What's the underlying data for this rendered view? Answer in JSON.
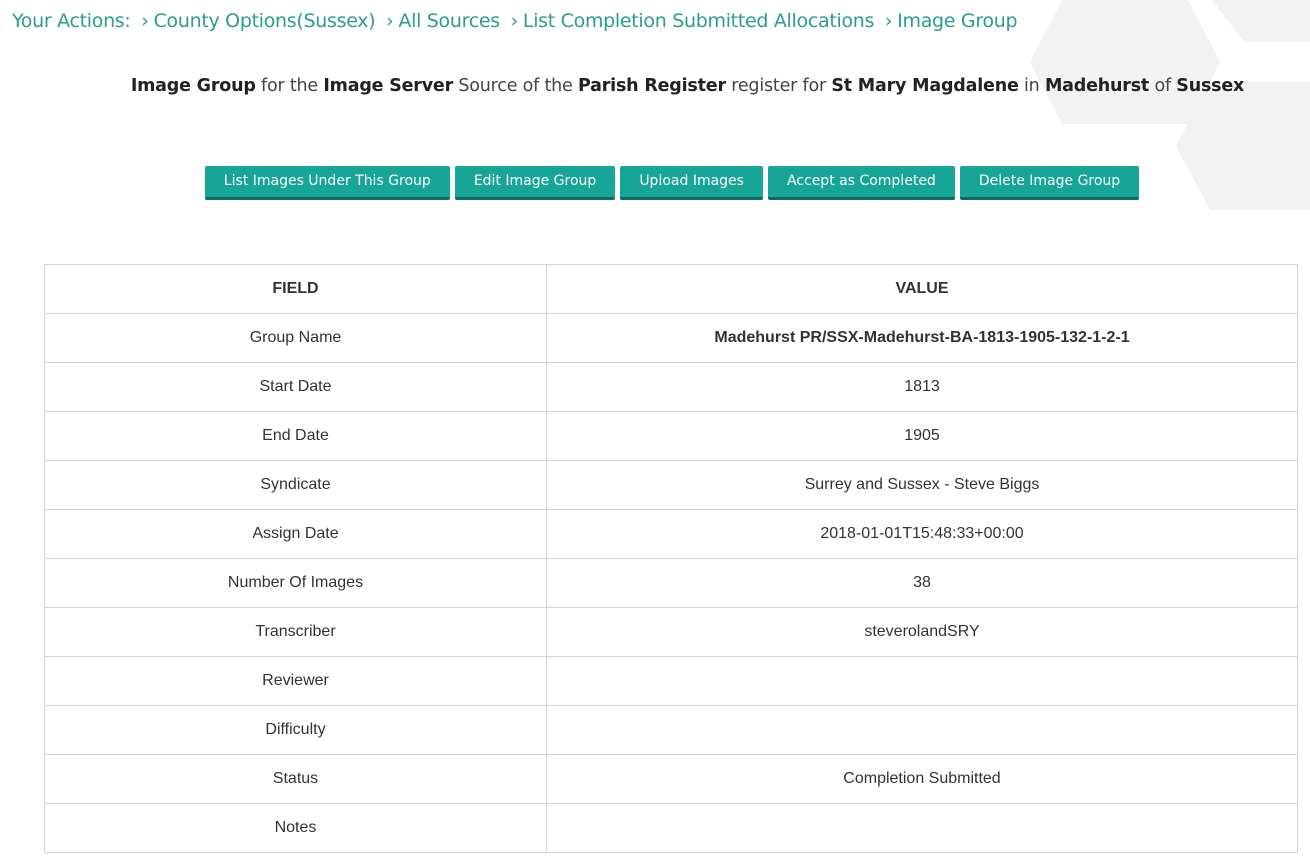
{
  "breadcrumb": {
    "prefix": "Your Actions:",
    "items": [
      "County Options(Sussex)",
      "All Sources",
      "List Completion Submitted Allocations",
      "Image Group"
    ]
  },
  "heading": {
    "t1": "Image Group",
    "t2": " for the ",
    "t3": "Image Server",
    "t4": " Source of the ",
    "t5": "Parish Register",
    "t6": " register for ",
    "t7": "St Mary Magdalene",
    "t8": " in ",
    "t9": "Madehurst",
    "t10": " of ",
    "t11": "Sussex"
  },
  "buttons": {
    "list_images": "List Images Under This Group",
    "edit_group": "Edit Image Group",
    "upload_images": "Upload Images",
    "accept_completed": "Accept as Completed",
    "delete_group": "Delete Image Group"
  },
  "table": {
    "headers": {
      "field": "FIELD",
      "value": "VALUE"
    },
    "rows": [
      {
        "field": "Group Name",
        "value": "Madehurst PR/SSX-Madehurst-BA-1813-1905-132-1-2-1"
      },
      {
        "field": "Start Date",
        "value": "1813"
      },
      {
        "field": "End Date",
        "value": "1905"
      },
      {
        "field": "Syndicate",
        "value": "Surrey and Sussex - Steve Biggs"
      },
      {
        "field": "Assign Date",
        "value": "2018-01-01T15:48:33+00:00"
      },
      {
        "field": "Number Of Images",
        "value": "38"
      },
      {
        "field": "Transcriber",
        "value": "steverolandSRY"
      },
      {
        "field": "Reviewer",
        "value": ""
      },
      {
        "field": "Difficulty",
        "value": ""
      },
      {
        "field": "Status",
        "value": "Completion Submitted"
      },
      {
        "field": "Notes",
        "value": ""
      }
    ]
  },
  "colors": {
    "accent": "#2a9d8f",
    "button": "#17a598",
    "hex_bg": "#f2f2f2"
  }
}
